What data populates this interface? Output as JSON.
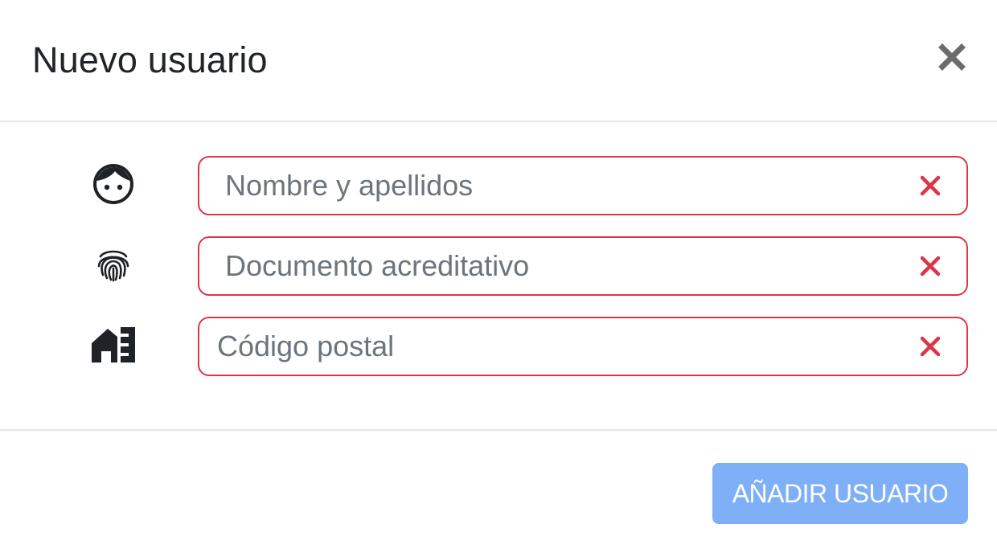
{
  "modal": {
    "title": "Nuevo usuario",
    "close_icon": "close-icon"
  },
  "form": {
    "fields": [
      {
        "icon": "face-icon",
        "placeholder": "Nombre y apellidos",
        "value": "",
        "state": "invalid",
        "status_icon": "invalid-x-icon"
      },
      {
        "icon": "fingerprint-icon",
        "placeholder": "Documento acreditativo",
        "value": "",
        "state": "invalid",
        "status_icon": "invalid-x-icon"
      },
      {
        "icon": "house-siding-icon",
        "placeholder": "Código postal",
        "value": "",
        "state": "invalid",
        "status_icon": "invalid-x-icon"
      }
    ]
  },
  "footer": {
    "submit_label": "AÑADIR USUARIO"
  },
  "colors": {
    "invalid": "#dc3545",
    "primary_disabled": "#7fb0f7",
    "title_text": "#212529",
    "placeholder": "#6c757d",
    "close_icon": "#6c6c6c",
    "divider": "#e3e5e8"
  }
}
